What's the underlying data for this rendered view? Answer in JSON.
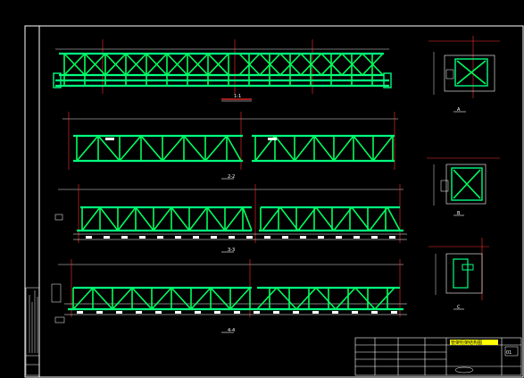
{
  "drawing": {
    "title_block": {
      "project_label": "管架桁架结构图",
      "sheet_no": "01"
    },
    "views": [
      {
        "id": "plan",
        "label": "1-1"
      },
      {
        "id": "elevation-1",
        "label": "2-2"
      },
      {
        "id": "elevation-2",
        "label": "3-3"
      },
      {
        "id": "elevation-3",
        "label": "4-4"
      }
    ],
    "details": [
      {
        "id": "detail-a",
        "label": "A"
      },
      {
        "id": "detail-b",
        "label": "B"
      },
      {
        "id": "detail-c",
        "label": "C"
      }
    ]
  }
}
